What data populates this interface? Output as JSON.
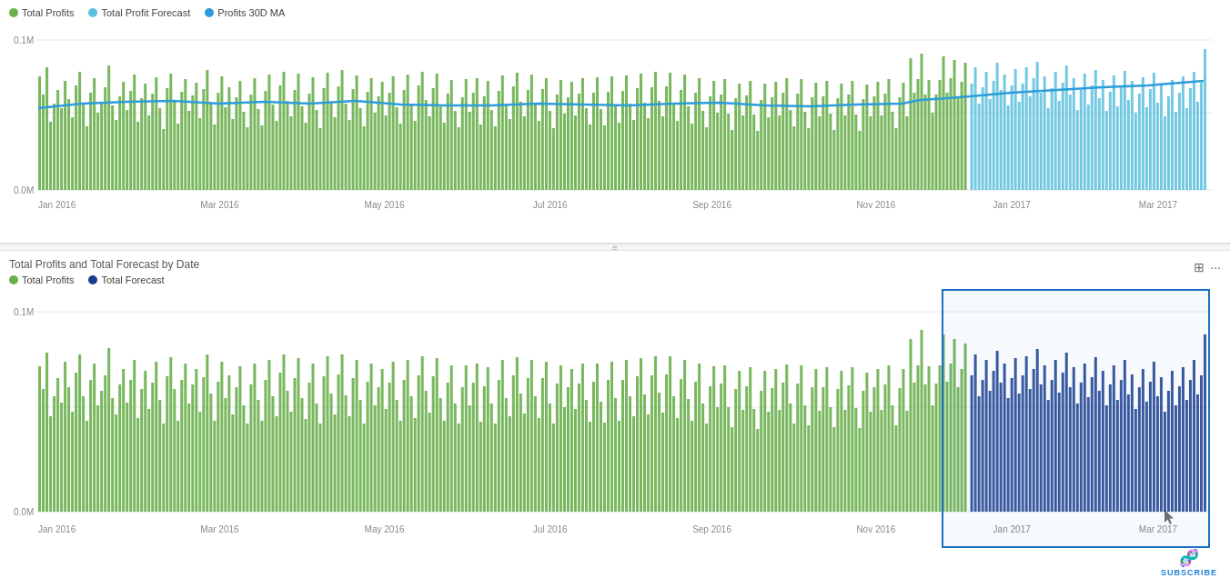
{
  "chart_top": {
    "legend": [
      {
        "label": "Total Profits",
        "color": "#6ab04c"
      },
      {
        "label": "Total Profit Forecast",
        "color": "#5bc0de"
      },
      {
        "label": "Profits 30D MA",
        "color": "#2d9cdb"
      }
    ],
    "y_labels": [
      "0.1M",
      "0.0M"
    ],
    "x_labels": [
      "Jan 2016",
      "Mar 2016",
      "May 2016",
      "Jul 2016",
      "Sep 2016",
      "Nov 2016",
      "Jan 2017",
      "Mar 2017"
    ]
  },
  "divider": {
    "icon": "≡"
  },
  "chart_bottom": {
    "title": "Total Profits and Total Forecast by Date",
    "legend": [
      {
        "label": "Total Profits",
        "color": "#6ab04c"
      },
      {
        "label": "Total Forecast",
        "color": "#1a3d8f"
      }
    ],
    "y_labels": [
      "0.1M",
      "0.0M"
    ],
    "x_labels": [
      "Jan 2016",
      "Mar 2016",
      "May 2016",
      "Jul 2016",
      "Sep 2016",
      "Nov 2016",
      "Jan 2017",
      "Mar 2017"
    ],
    "selection_x_labels": [
      "Jan 2017",
      "Mar 2017"
    ]
  },
  "toolbar": {
    "expand_label": "⊞",
    "more_label": "···"
  },
  "subscribe": {
    "label": "SUBSCRIBE"
  }
}
